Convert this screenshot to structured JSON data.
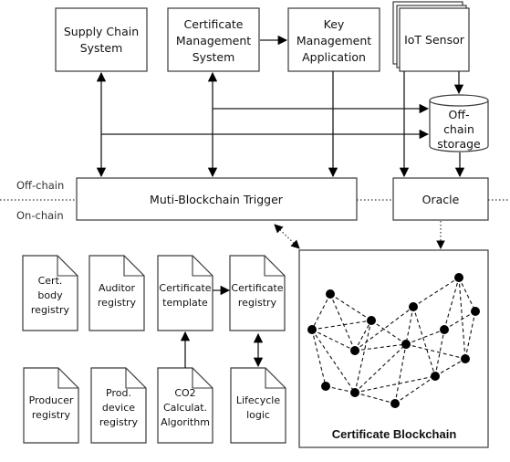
{
  "diagram": {
    "zones": {
      "off_chain": "Off-chain",
      "on_chain": "On-chain"
    },
    "top_systems": {
      "supply_chain": [
        "Supply Chain",
        "System"
      ],
      "cert_mgmt": [
        "Certificate",
        "Management",
        "System"
      ],
      "key_mgmt": [
        "Key",
        "Management",
        "Application"
      ],
      "iot": [
        "IoT Sensor"
      ]
    },
    "storage": [
      "Off-",
      "chain",
      "storage"
    ],
    "trigger": "Muti-Blockchain Trigger",
    "oracle": "Oracle",
    "contracts": {
      "cert_body_registry": [
        "Cert.",
        "body",
        "registry"
      ],
      "auditor_registry": [
        "Auditor",
        "registry"
      ],
      "certificate_template": [
        "Certificate",
        "template"
      ],
      "certificate_registry": [
        "Certificate",
        "registry"
      ],
      "producer_registry": [
        "Producer",
        "registry"
      ],
      "prod_device_registry": [
        "Prod.",
        "device",
        "registry"
      ],
      "co2_algorithm": [
        "CO2",
        "Calculat.",
        "Algorithm"
      ],
      "lifecycle_logic": [
        "Lifecycle",
        "logic"
      ]
    },
    "blockchain_title": "Certificate Blockchain",
    "network": {
      "nodes": 14,
      "edges": [
        [
          0,
          1
        ],
        [
          0,
          2
        ],
        [
          0,
          3
        ],
        [
          1,
          2
        ],
        [
          1,
          3
        ],
        [
          1,
          4
        ],
        [
          1,
          5
        ],
        [
          2,
          3
        ],
        [
          2,
          8
        ],
        [
          2,
          7
        ],
        [
          3,
          8
        ],
        [
          3,
          5
        ],
        [
          4,
          5
        ],
        [
          5,
          8
        ],
        [
          5,
          6
        ],
        [
          5,
          9
        ],
        [
          6,
          8
        ],
        [
          6,
          9
        ],
        [
          7,
          8
        ],
        [
          7,
          9
        ],
        [
          7,
          11
        ],
        [
          8,
          10
        ],
        [
          8,
          13
        ],
        [
          9,
          13
        ],
        [
          9,
          10
        ],
        [
          10,
          11
        ],
        [
          10,
          12
        ],
        [
          11,
          12
        ],
        [
          11,
          13
        ],
        [
          12,
          13
        ]
      ]
    }
  }
}
